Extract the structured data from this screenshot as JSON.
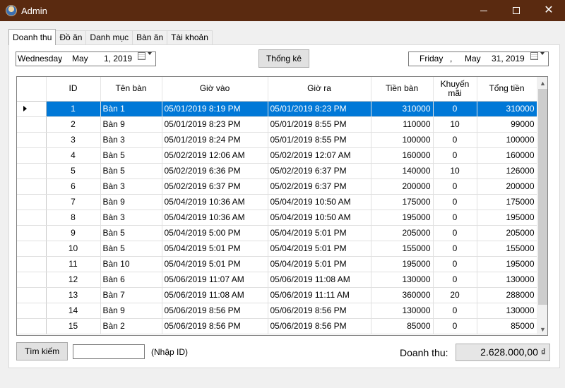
{
  "window": {
    "title": "Admin"
  },
  "tabs": [
    "Doanh thu",
    "Đồ ăn",
    "Danh mục",
    "Bàn ăn",
    "Tài khoản"
  ],
  "date_from": {
    "weekday": "Wednesday",
    "sep": ",",
    "month": "May",
    "day": "1, 2019"
  },
  "date_to": {
    "weekday": "Friday",
    "sep": ",",
    "month": "May",
    "day": "31, 2019"
  },
  "stats_button": "Thống kê",
  "table": {
    "columns": [
      "ID",
      "Tên bàn",
      "Giờ vào",
      "Giờ ra",
      "Tiền bàn",
      "Khuyến mãi",
      "Tổng tiền"
    ],
    "selected_index": 0,
    "rows": [
      [
        "1",
        "Bàn 1",
        "05/01/2019 8:19 PM",
        "05/01/2019 8:23 PM",
        "310000",
        "0",
        "310000"
      ],
      [
        "2",
        "Bàn 9",
        "05/01/2019 8:23 PM",
        "05/01/2019 8:55 PM",
        "110000",
        "10",
        "99000"
      ],
      [
        "3",
        "Bàn 3",
        "05/01/2019 8:24 PM",
        "05/01/2019 8:55 PM",
        "100000",
        "0",
        "100000"
      ],
      [
        "4",
        "Bàn 5",
        "05/02/2019 12:06 AM",
        "05/02/2019 12:07 AM",
        "160000",
        "0",
        "160000"
      ],
      [
        "5",
        "Bàn 5",
        "05/02/2019 6:36 PM",
        "05/02/2019 6:37 PM",
        "140000",
        "10",
        "126000"
      ],
      [
        "6",
        "Bàn 3",
        "05/02/2019 6:37 PM",
        "05/02/2019 6:37 PM",
        "200000",
        "0",
        "200000"
      ],
      [
        "7",
        "Bàn 9",
        "05/04/2019 10:36 AM",
        "05/04/2019 10:50 AM",
        "175000",
        "0",
        "175000"
      ],
      [
        "8",
        "Bàn 3",
        "05/04/2019 10:36 AM",
        "05/04/2019 10:50 AM",
        "195000",
        "0",
        "195000"
      ],
      [
        "9",
        "Bàn 5",
        "05/04/2019 5:00 PM",
        "05/04/2019 5:01 PM",
        "205000",
        "0",
        "205000"
      ],
      [
        "10",
        "Bàn 5",
        "05/04/2019 5:01 PM",
        "05/04/2019 5:01 PM",
        "155000",
        "0",
        "155000"
      ],
      [
        "11",
        "Bàn 10",
        "05/04/2019 5:01 PM",
        "05/04/2019 5:01 PM",
        "195000",
        "0",
        "195000"
      ],
      [
        "12",
        "Bàn 6",
        "05/06/2019 11:07 AM",
        "05/06/2019 11:08 AM",
        "130000",
        "0",
        "130000"
      ],
      [
        "13",
        "Bàn 7",
        "05/06/2019 11:08 AM",
        "05/06/2019 11:11 AM",
        "360000",
        "20",
        "288000"
      ],
      [
        "14",
        "Bàn 9",
        "05/06/2019 8:56 PM",
        "05/06/2019 8:56 PM",
        "130000",
        "0",
        "130000"
      ],
      [
        "15",
        "Bàn 2",
        "05/06/2019 8:56 PM",
        "05/06/2019 8:56 PM",
        "85000",
        "0",
        "85000"
      ]
    ]
  },
  "search": {
    "button": "Tìm kiếm",
    "value": "",
    "hint": "(Nhập ID)"
  },
  "revenue": {
    "label": "Doanh thu:",
    "value": "2.628.000,00 ₫"
  },
  "colors": {
    "titlebar": "#5a2a10",
    "selection": "#0078d7"
  }
}
